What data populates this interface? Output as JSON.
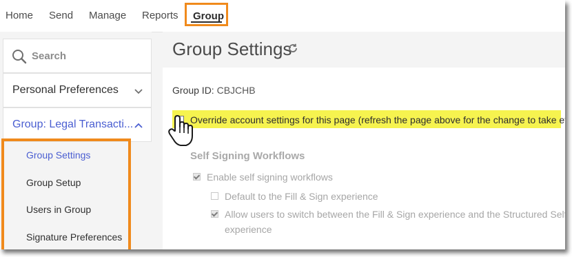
{
  "nav": {
    "items": [
      "Home",
      "Send",
      "Manage",
      "Reports"
    ],
    "active": "Group"
  },
  "sidebar": {
    "search_placeholder": "Search",
    "personal_label": "Personal Preferences",
    "group_label": "Group: Legal Transacti...",
    "sub_items": [
      "Group Settings",
      "Group Setup",
      "Users in Group",
      "Signature Preferences"
    ]
  },
  "main": {
    "title": "Group Settings",
    "group_id_label": "Group ID:",
    "group_id_value": "CBJCHB",
    "override_label": "Override account settings for this page (refresh the page above for the change to take effect)",
    "section_title": "Self Signing Workflows",
    "enable_label": "Enable self signing workflows",
    "default_label": "Default to the Fill & Sign experience",
    "allow_label_line1": "Allow users to switch between the Fill & Sign experience and the Structured Self Sign",
    "allow_label_line2": "experience"
  },
  "colors": {
    "accent_orange": "#f08a1c",
    "link_blue": "#4a5ed1",
    "highlight_yellow": "#f6f34f"
  }
}
